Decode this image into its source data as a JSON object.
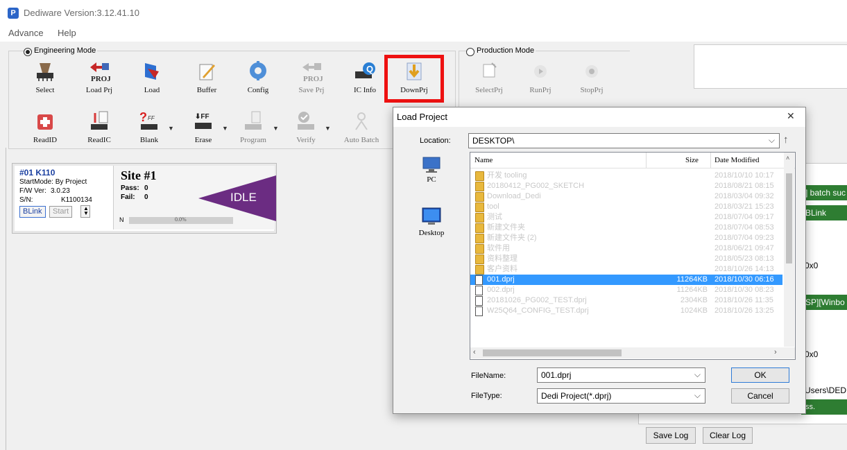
{
  "app": {
    "title": "Dediware Version:3.12.41.10",
    "logo_letter": "P"
  },
  "menu": [
    "Advance",
    "Help"
  ],
  "engineering": {
    "label": "Engineering Mode",
    "row1": [
      {
        "label": "Select",
        "icon": "select-chip-icon",
        "enabled": true
      },
      {
        "label": "Load Prj",
        "icon": "load-project-icon",
        "enabled": true
      },
      {
        "label": "Load",
        "icon": "load-file-icon",
        "enabled": true
      },
      {
        "label": "Buffer",
        "icon": "buffer-edit-icon",
        "enabled": true
      },
      {
        "label": "Config",
        "icon": "config-gear-icon",
        "enabled": true
      },
      {
        "label": "Save Prj",
        "icon": "save-project-icon",
        "enabled": false
      },
      {
        "label": "IC Info",
        "icon": "ic-info-icon",
        "enabled": true
      },
      {
        "label": "DownPrj",
        "icon": "download-project-icon",
        "enabled": true,
        "highlighted": true
      }
    ],
    "row2": [
      {
        "label": "ReadID",
        "icon": "read-id-icon",
        "enabled": true
      },
      {
        "label": "ReadIC",
        "icon": "read-ic-icon",
        "enabled": true
      },
      {
        "label": "Blank",
        "icon": "blank-check-icon",
        "enabled": true
      },
      {
        "label": "Erase",
        "icon": "erase-icon",
        "enabled": true
      },
      {
        "label": "Program",
        "icon": "program-icon",
        "enabled": false
      },
      {
        "label": "Verify",
        "icon": "verify-icon",
        "enabled": false
      },
      {
        "label": "Auto Batch",
        "icon": "auto-batch-icon",
        "enabled": false
      }
    ]
  },
  "production": {
    "label": "Production Mode",
    "buttons": [
      {
        "label": "SelectPrj",
        "icon": "select-project-icon"
      },
      {
        "label": "RunPrj",
        "icon": "run-project-icon"
      },
      {
        "label": "StopPrj",
        "icon": "stop-project-icon"
      }
    ]
  },
  "site": {
    "id": "#01 K110",
    "startmode": "StartMode:  By Project",
    "fw_label": "F/W Ver:",
    "fw_value": "3.0.23",
    "sn_label": "S/N:",
    "sn_value": "K1100134",
    "blink": "BLink",
    "start": "Start",
    "title": "Site #1",
    "pass_label": "Pass:",
    "pass_value": "0",
    "fail_label": "Fail:",
    "fail_value": "0",
    "status": "IDLE",
    "progress_label": "N",
    "progress_text": "0.0%",
    "progress": 0,
    "status_color": "#6b2c82"
  },
  "log": {
    "line1": "] batch suc",
    "line2": "BLink",
    "line3": "0x0",
    "line4": "SP][Winbo",
    "line5": "0x0",
    "line6": "Users\\DED",
    "line7": "ss.",
    "save_log": "Save Log",
    "clear_log": "Clear Log",
    "accent": "#2e7d32"
  },
  "dialog": {
    "title": "Load Project",
    "location_label": "Location:",
    "location_value": "DESKTOP\\",
    "places": [
      {
        "label": "PC",
        "icon": "pc-icon"
      },
      {
        "label": "Desktop",
        "icon": "desktop-icon"
      }
    ],
    "columns": {
      "name": "Name",
      "size": "Size",
      "date": "Date Modified"
    },
    "rows": [
      {
        "type": "folder",
        "name": "开发 tooling",
        "size": "",
        "date": "2018/10/10 10:17"
      },
      {
        "type": "folder",
        "name": "20180412_PG002_SKETCH",
        "size": "",
        "date": "2018/08/21 08:15"
      },
      {
        "type": "folder",
        "name": "Download_Dedi",
        "size": "",
        "date": "2018/03/04 09:32"
      },
      {
        "type": "folder",
        "name": "tool",
        "size": "",
        "date": "2018/03/21 15:23"
      },
      {
        "type": "folder",
        "name": "测试",
        "size": "",
        "date": "2018/07/04 09:17"
      },
      {
        "type": "folder",
        "name": "新建文件夹",
        "size": "",
        "date": "2018/07/04 08:53"
      },
      {
        "type": "folder",
        "name": "新建文件夹 (2)",
        "size": "",
        "date": "2018/07/04 09:23"
      },
      {
        "type": "folder",
        "name": "软件用",
        "size": "",
        "date": "2018/06/21 09:47"
      },
      {
        "type": "folder",
        "name": "资料整理",
        "size": "",
        "date": "2018/05/23 08:13"
      },
      {
        "type": "folder",
        "name": "客户资料",
        "size": "",
        "date": "2018/10/26 14:13"
      },
      {
        "type": "file",
        "name": "001.dprj",
        "size": "11264KB",
        "date": "2018/10/30 06:16",
        "selected": true
      },
      {
        "type": "file",
        "name": "002.dprj",
        "size": "11264KB",
        "date": "2018/10/30 08:23"
      },
      {
        "type": "file",
        "name": "20181026_PG002_TEST.dprj",
        "size": "2304KB",
        "date": "2018/10/26 11:35"
      },
      {
        "type": "file",
        "name": "W25Q64_CONFIG_TEST.dprj",
        "size": "1024KB",
        "date": "2018/10/26 13:25"
      }
    ],
    "filename_label": "FileName:",
    "filename_value": "001.dprj",
    "filetype_label": "FileType:",
    "filetype_value": "Dedi Project(*.dprj)",
    "ok": "OK",
    "cancel": "Cancel",
    "close_glyph": "✕",
    "up_glyph": "↑"
  }
}
